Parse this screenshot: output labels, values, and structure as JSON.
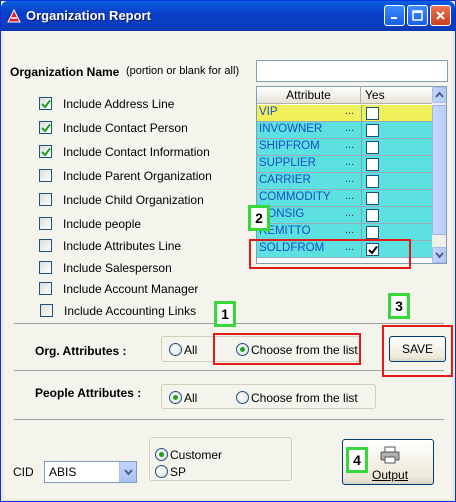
{
  "window": {
    "title": "Organization Report"
  },
  "org_name": {
    "label": "Organization Name",
    "hint": "(portion or blank for all)",
    "value": ""
  },
  "options": [
    {
      "label": "Include Address Line",
      "checked": true
    },
    {
      "label": "Include Contact Person",
      "checked": true
    },
    {
      "label": "Include Contact Information",
      "checked": true
    },
    {
      "label": "Include Parent Organization",
      "checked": false
    },
    {
      "label": "Include Child Organization",
      "checked": false
    },
    {
      "label": "Include people",
      "checked": false
    },
    {
      "label": "Include Attributes Line",
      "checked": false
    },
    {
      "label": "Include Salesperson",
      "checked": false
    },
    {
      "label": "Include Account Manager",
      "checked": false
    },
    {
      "label": "Include Accounting Links",
      "checked": false
    }
  ],
  "attr_grid": {
    "headers": [
      "Attribute",
      "Yes"
    ],
    "rows": [
      {
        "name": "VIP",
        "dots": "...",
        "yes": false,
        "selected": true
      },
      {
        "name": "INVOWNER",
        "dots": "...",
        "yes": false
      },
      {
        "name": "SHIPFROM",
        "dots": "...",
        "yes": false
      },
      {
        "name": "SUPPLIER",
        "dots": "...",
        "yes": false
      },
      {
        "name": "CARRIER",
        "dots": "...",
        "yes": false
      },
      {
        "name": "COMMODITY",
        "dots": "...",
        "yes": false
      },
      {
        "name": "CONSIG",
        "dots": "...",
        "yes": false
      },
      {
        "name": "REMITTO",
        "dots": "...",
        "yes": false
      },
      {
        "name": "SOLDFROM",
        "dots": "...",
        "yes": true
      }
    ]
  },
  "org_attributes": {
    "label": "Org. Attributes :",
    "opt_all": "All",
    "opt_choose": "Choose from the list",
    "selected": "choose"
  },
  "people_attributes": {
    "label": "People Attributes :",
    "opt_all": "All",
    "opt_choose": "Choose from the list",
    "selected": "all"
  },
  "save_button": "SAVE",
  "cid": {
    "label": "CID",
    "value": "ABIS"
  },
  "type_radios": {
    "customer": "Customer",
    "sp": "SP",
    "selected": "customer"
  },
  "output_button": "Output",
  "annotations": [
    "1",
    "2",
    "3",
    "4"
  ],
  "colors": {
    "annotation_box": "#e21a1a",
    "badge_border": "#36d83a",
    "grid_row": "#5de0e0",
    "grid_selected": "#f0f05a"
  }
}
